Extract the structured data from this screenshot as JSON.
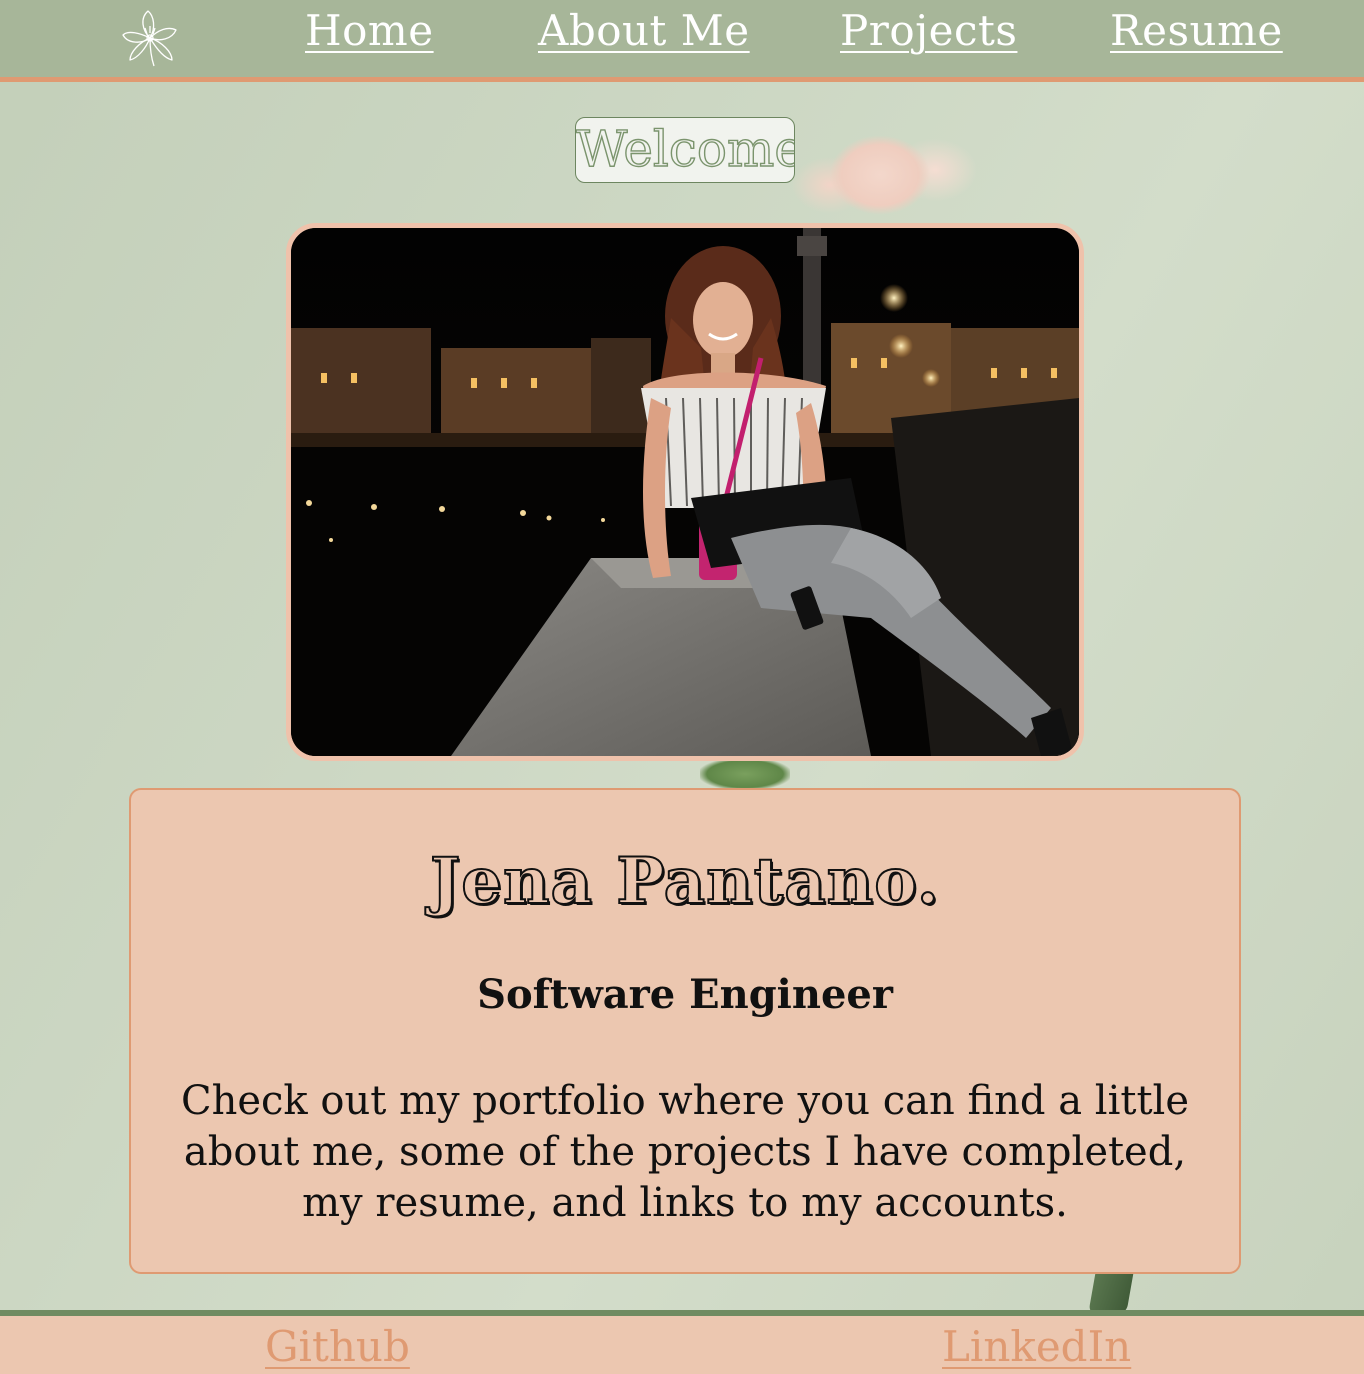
{
  "nav": {
    "logo_icon": "flower-icon",
    "links": [
      {
        "label": "Home"
      },
      {
        "label": "About Me"
      },
      {
        "label": "Projects"
      },
      {
        "label": "Resume"
      }
    ]
  },
  "hero": {
    "welcome": "Welcome",
    "photo_alt_icon": "profile-photo"
  },
  "intro": {
    "name": "Jena Pantano.",
    "role": "Software Engineer",
    "blurb": "Check out my portfolio where you can find a little about me, some of the projects I have completed, my resume, and links to my accounts."
  },
  "footer": {
    "links": [
      {
        "label": "Github"
      },
      {
        "label": "LinkedIn"
      }
    ]
  },
  "colors": {
    "nav_bg": "#a7b699",
    "accent": "#df9a72",
    "card_bg": "#ecc7b0",
    "page_bg": "#ccd7c3",
    "footer_border": "#6f8b61"
  }
}
